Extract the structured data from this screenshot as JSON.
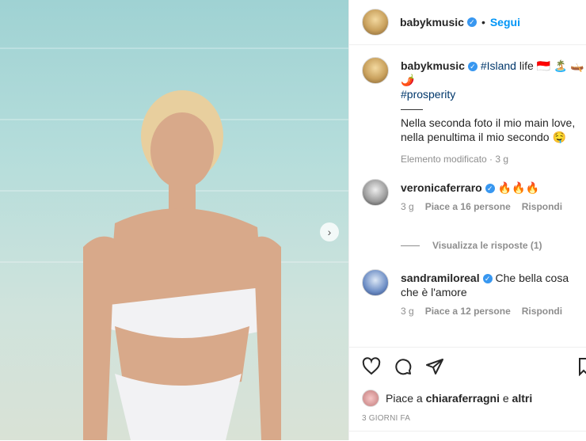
{
  "post": {
    "username": "babykmusic",
    "follow_label": "Segui",
    "separator": "•"
  },
  "caption": {
    "username": "babykmusic",
    "hashtag1": "#Island",
    "text1": " life 🇮🇩 🏝️ 🛶",
    "emoji_line": "🌶️",
    "hashtag2": "#prosperity",
    "divider": "——",
    "line1": "Nella seconda foto il mio main love,",
    "line2": "nella penultima il mio secondo 🤤",
    "meta": "Elemento modificato · 3 g"
  },
  "comments": [
    {
      "username": "veronicaferraro",
      "text": "🔥🔥🔥",
      "time": "3 g",
      "likes": "Piace a 16 persone",
      "reply": "Rispondi"
    },
    {
      "username": "sandramiloreal",
      "text": "Che bella cosa che è l'amore",
      "time": "3 g",
      "likes": "Piace a 12 persone",
      "reply": "Rispondi"
    }
  ],
  "view_replies": "Visualizza le risposte (1)",
  "likes": {
    "prefix": "Piace a ",
    "user": "chiaraferragni",
    "joiner": " e ",
    "others": "altri"
  },
  "timestamp": "3 GIORNI FA",
  "icons": [
    "heart-icon",
    "comment-icon",
    "share-icon",
    "bookmark-icon",
    "chevron-right-icon",
    "verified-icon"
  ],
  "colors": {
    "link": "#0095f6",
    "hashtag": "#00376b",
    "muted": "#8e8e8e",
    "verified": "#3897f0"
  }
}
